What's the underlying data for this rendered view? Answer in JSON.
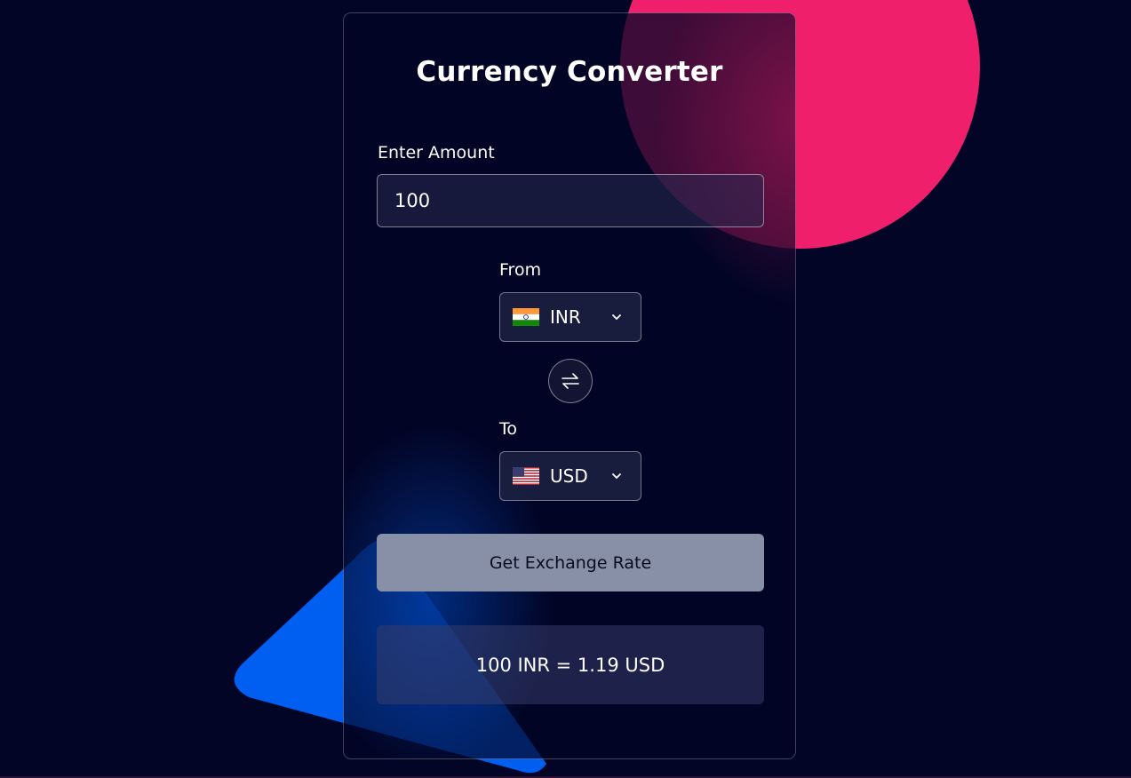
{
  "app": {
    "title": "Currency Converter"
  },
  "amount": {
    "label": "Enter Amount",
    "value": "100"
  },
  "from": {
    "label": "From",
    "currency": "INR",
    "flag": "india-flag"
  },
  "to": {
    "label": "To",
    "currency": "USD",
    "flag": "us-flag"
  },
  "actions": {
    "get_rate_label": "Get Exchange Rate"
  },
  "result": {
    "text": "100 INR = 1.19 USD"
  },
  "colors": {
    "background": "#020526",
    "accent_pink": "#ef1f6c",
    "accent_blue": "#005ff0",
    "button": "#8890a8"
  },
  "icons": {
    "swap": "swap-arrows-icon",
    "chevron": "chevron-down-icon"
  }
}
